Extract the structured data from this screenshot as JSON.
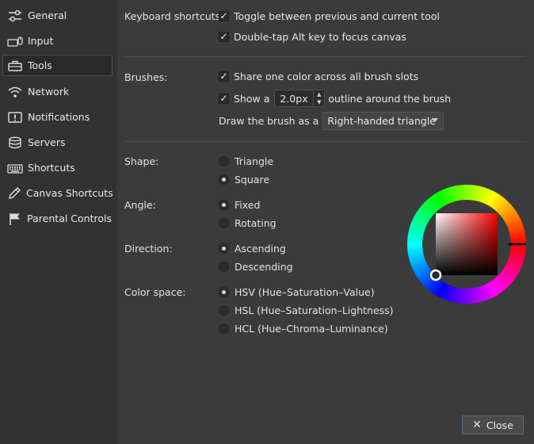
{
  "sidebar": {
    "items": [
      {
        "label": "General",
        "icon": "sliders-icon",
        "active": false
      },
      {
        "label": "Input",
        "icon": "keyboard-mouse-icon",
        "active": false
      },
      {
        "label": "Tools",
        "icon": "toolbox-icon",
        "active": true
      },
      {
        "label": "Network",
        "icon": "wifi-icon",
        "active": false
      },
      {
        "label": "Notifications",
        "icon": "notification-icon",
        "active": false
      },
      {
        "label": "Servers",
        "icon": "database-icon",
        "active": false
      },
      {
        "label": "Shortcuts",
        "icon": "keyboard-icon",
        "active": false
      },
      {
        "label": "Canvas Shortcuts",
        "icon": "pen-icon",
        "active": false
      },
      {
        "label": "Parental Controls",
        "icon": "flag-icon",
        "active": false
      }
    ]
  },
  "keyboard": {
    "label": "Keyboard shortcuts:",
    "toggle_label": "Toggle between previous and current tool",
    "toggle_checked": true,
    "alt_label": "Double-tap Alt key to focus canvas",
    "alt_checked": true
  },
  "brushes": {
    "label": "Brushes:",
    "share_label": "Share one color across all brush slots",
    "share_checked": true,
    "show_prefix": "Show a",
    "show_checked": true,
    "outline_value": "2.0px",
    "show_suffix": "outline around the brush",
    "draw_label": "Draw the brush as a",
    "draw_value": "Right-handed triangle"
  },
  "shape": {
    "label": "Shape:",
    "options": [
      "Triangle",
      "Square"
    ],
    "selected": "Square"
  },
  "angle": {
    "label": "Angle:",
    "options": [
      "Fixed",
      "Rotating"
    ],
    "selected": "Fixed"
  },
  "direction": {
    "label": "Direction:",
    "options": [
      "Ascending",
      "Descending"
    ],
    "selected": "Ascending"
  },
  "color_space": {
    "label": "Color space:",
    "options": [
      "HSV (Hue–Saturation–Value)",
      "HSL (Hue–Saturation–Lightness)",
      "HCL (Hue–Chroma–Luminance)"
    ],
    "selected": "HSV (Hue–Saturation–Value)"
  },
  "color_wheel": {
    "hue_color": "#ff0000",
    "selected_color": "#000000"
  },
  "footer": {
    "close_label": "Close"
  },
  "colors": {
    "background": "#3b3b3b",
    "sidebar": "#323232",
    "accent_border": "#5f6d7d"
  }
}
